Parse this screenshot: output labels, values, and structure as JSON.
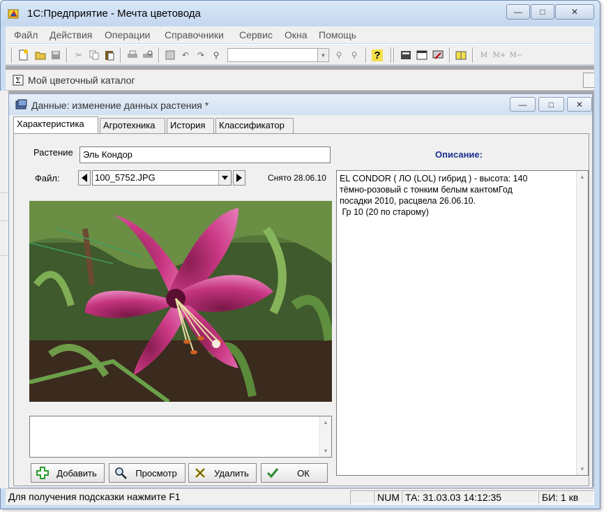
{
  "app": {
    "title": "1С:Предприятие - Мечта цветовода",
    "caption_buttons": {
      "minimize": "—",
      "maximize": "□",
      "close": "✕"
    }
  },
  "menu": [
    "Файл",
    "Действия",
    "Операции",
    "Справочники",
    "Сервис",
    "Окна",
    "Помощь"
  ],
  "toolbar": {
    "combo_value": "",
    "memory_buttons": [
      "M",
      "M+",
      "M−"
    ]
  },
  "catalog_window": {
    "title": "Мой цветочный каталог"
  },
  "form": {
    "title": "Данные: изменение данных растения *",
    "tabs": [
      "Характеристика",
      "Агротехника",
      "История",
      "Классификатор"
    ],
    "active_tab": 0,
    "plant_label": "Растение",
    "plant_value": "Эль Кондор",
    "file_label": "Файл:",
    "file_value": "100_5752.JPG",
    "taken_label": "Снято 28.06.10",
    "description_label": "Описание:",
    "description_lines": [
      "EL CONDOR ( ЛО (LOL) гибрид ) - высота: 140",
      "тёмно-розовый с тонким белым кантомГод",
      "посадки   2010,  расцвела 26.06.10.",
      " Гр 10 (20 по старому)"
    ],
    "buttons": {
      "add": "Добавить",
      "view": "Просмотр",
      "delete": "Удалить",
      "ok": "ОК"
    }
  },
  "status": {
    "hint": "Для получения подсказки нажмите F1",
    "num": "NUM",
    "ta": "ТА: 31.03.03  14:12:35",
    "bi": "БИ: 1 кв"
  },
  "colors": {
    "title_gradient": "#c3d7ef",
    "description_label": "#1a2f8a",
    "window_bg": "#f0f0f0"
  }
}
